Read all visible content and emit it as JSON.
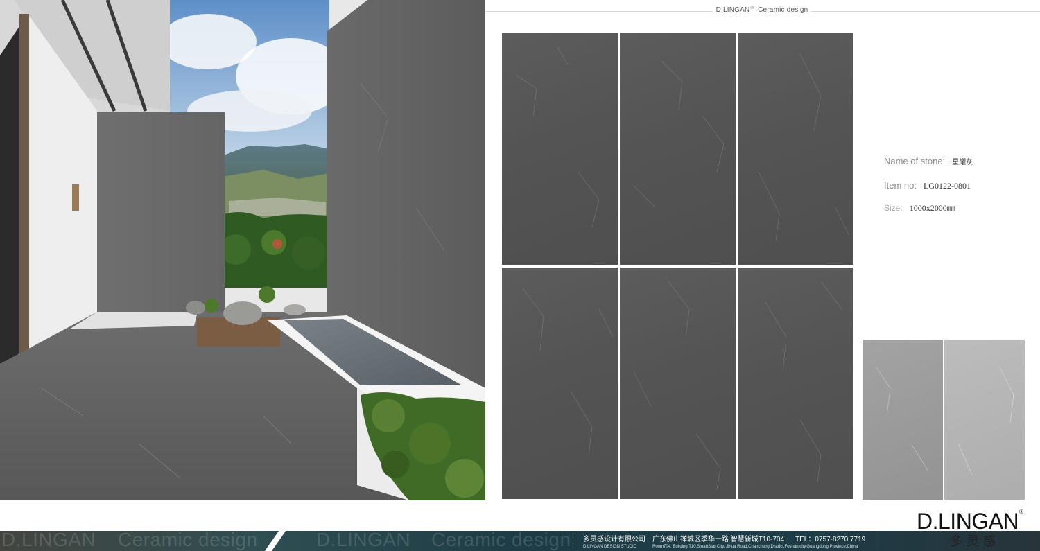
{
  "header": {
    "brand": "D.LINGAN",
    "brand_mark": "®",
    "subtitle": "Ceramic design"
  },
  "product": {
    "name_label": "Name  of stone:",
    "name_value": "星耀灰",
    "item_label": "Item no:",
    "item_value": "LG0122-0801",
    "size_label": "Size:",
    "size_value": "1000x2000㎜"
  },
  "logo": {
    "brand": "D.LINGAN",
    "brand_mark": "®",
    "chinese": "多灵感"
  },
  "footer": {
    "band_brand_1": "D.LINGAN",
    "band_sub_1": "Ceramic design",
    "band_brand_2": "D.LINGAN",
    "band_sub_2": "Ceramic design",
    "company_cn": "多灵感设计有限公司",
    "studio_en": "D.LINGAN DESIGN STUDIO",
    "address_cn": "广东佛山禅城区季华一路  智慧新城T10-704",
    "tel": "TEL：0757-8270 7719",
    "address_en": "Room704, Building T10,SmartStar City, Jihua Road,Chancheng  District,Foshan  city,Guangdong Province,China"
  },
  "colors": {
    "tile_dark": "#555555",
    "tile_light": "#9c9c9c",
    "tile_lighter": "#b4b4b4",
    "band": "#1e3c45"
  }
}
